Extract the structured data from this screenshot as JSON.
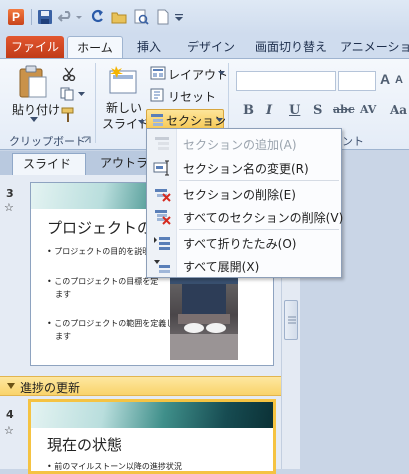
{
  "qat": {
    "app_letter": "P"
  },
  "tabs": [
    {
      "label": "ファイル"
    },
    {
      "label": "ホーム"
    },
    {
      "label": "挿入"
    },
    {
      "label": "デザイン"
    },
    {
      "label": "画面切り替え"
    },
    {
      "label": "アニメーション"
    }
  ],
  "ribbon": {
    "paste_label": "貼り付け",
    "clipboard_group": "クリップボード",
    "new_slide_label_1": "新しい",
    "new_slide_label_2": "スライド",
    "layout_label": "レイアウト",
    "reset_label": "リセット",
    "section_label": "セクション",
    "font_grow": "A",
    "font_shrink": "A",
    "format_buttons": [
      "B",
      "I",
      "U",
      "S",
      "abc",
      "AV",
      "Aa"
    ],
    "font_group_fragment": "ント"
  },
  "panel": {
    "tab_slides": "スライド",
    "tab_outline": "アウトライン"
  },
  "slides": [
    {
      "number": "3",
      "marker": "☆",
      "title": "プロジェクトの概",
      "bullets": [
        "プロジェクトの目的を説明し",
        "このプロジェクトの目標を定",
        "ます",
        "このプロジェクトの範囲を定義し",
        "ます"
      ]
    },
    {
      "number": "4",
      "marker": "☆",
      "title": "現在の状態",
      "bullets": [
        "前のマイルストーン以降の進捗状況"
      ]
    }
  ],
  "section_header": "進捗の更新",
  "menu": {
    "items": [
      {
        "label": "セクションの追加(A)",
        "icon": "add-section-icon",
        "disabled": true
      },
      {
        "label": "セクション名の変更(R)",
        "icon": "rename-section-icon",
        "disabled": false
      },
      {
        "label": "セクションの削除(E)",
        "icon": "delete-section-icon",
        "disabled": false
      },
      {
        "label": "すべてのセクションの削除(V)",
        "icon": "delete-all-sections-icon",
        "disabled": false
      },
      {
        "label": "すべて折りたたみ(O)",
        "icon": "collapse-all-icon",
        "disabled": false
      },
      {
        "label": "すべて展開(X)",
        "icon": "expand-all-icon",
        "disabled": false
      }
    ]
  },
  "colors": {
    "file_tab": "#d04a22",
    "section_highlight": "#f9d36a",
    "menu_border": "#8d9fb8"
  }
}
